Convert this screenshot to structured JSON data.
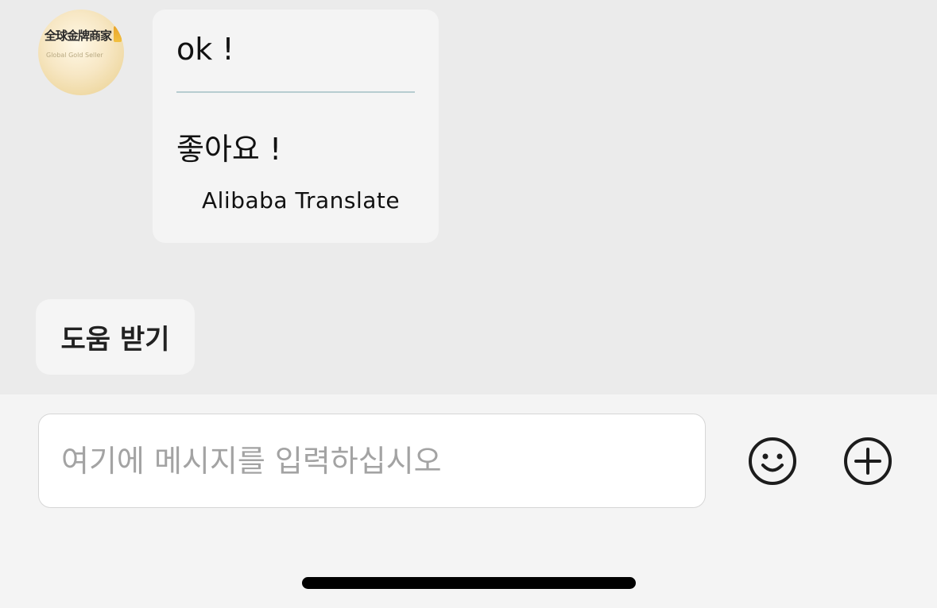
{
  "seller": {
    "avatar_title": "全球金牌商家",
    "avatar_subtitle": "Global Gold Seller"
  },
  "message": {
    "original_text": "ok !",
    "translated_text": "좋아요 !",
    "translation_source": "Alibaba Translate"
  },
  "quick_actions": {
    "help_label": "도움 받기"
  },
  "composer": {
    "placeholder": "여기에 메시지를 입력하십시오",
    "value": ""
  },
  "icons": {
    "emoji": "smiley-face-icon",
    "add": "plus-circle-icon",
    "medal": "gold-medal-icon"
  },
  "colors": {
    "chat_background": "#ebebeb",
    "bubble_background": "#f4f4f4",
    "divider": "#b7ccd0",
    "placeholder_text": "#a3a3a3"
  }
}
